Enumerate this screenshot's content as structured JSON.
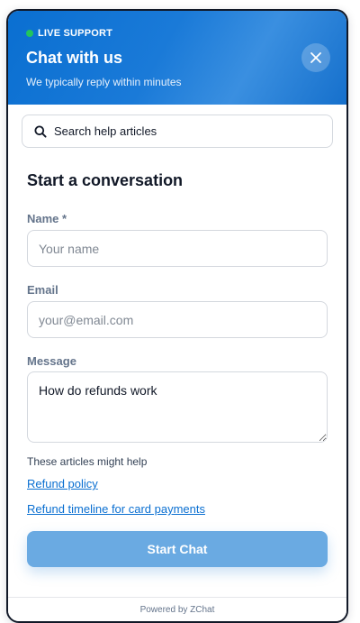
{
  "header": {
    "status_label": "LIVE SUPPORT",
    "title": "Chat with us",
    "subtitle": "We typically reply within minutes",
    "status_color": "#22c55e",
    "brand_color": "#0a6fd1"
  },
  "icons": {
    "close": "close-icon",
    "search": "search-icon"
  },
  "search": {
    "placeholder": "Search help articles"
  },
  "form": {
    "title": "Start a conversation",
    "name_label": "Name *",
    "name_placeholder": "Your name",
    "email_label": "Email",
    "email_placeholder": "your@email.com",
    "message_label": "Message",
    "message_value": "How do refunds work"
  },
  "suggestions": {
    "heading": "These articles might help",
    "links": [
      "Refund policy",
      "Refund timeline for card payments"
    ]
  },
  "submit": {
    "label": "Start Chat"
  },
  "footer": {
    "text": "Powered by ZChat"
  }
}
